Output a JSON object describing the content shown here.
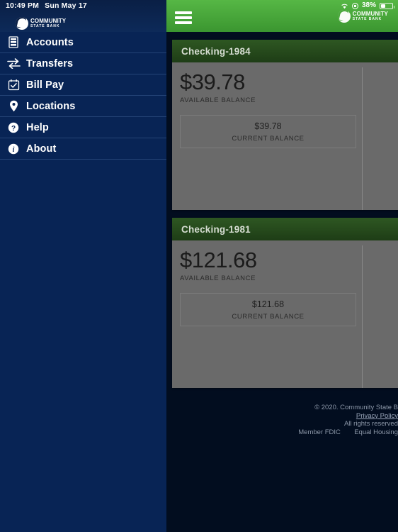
{
  "status_bar": {
    "time": "10:49 PM",
    "date": "Sun May 17",
    "battery_percent": "38%",
    "icons": [
      "wifi-icon",
      "rotation-lock-icon",
      "battery-icon"
    ]
  },
  "brand": {
    "logo_line1": "COMMUNITY",
    "logo_line2": "STATE  BANK",
    "green": "#4caf3f",
    "navy": "#082455"
  },
  "sidebar": {
    "items": [
      {
        "label": "Accounts",
        "icon": "bank-drawer-icon"
      },
      {
        "label": "Transfers",
        "icon": "transfer-arrows-icon"
      },
      {
        "label": "Bill Pay",
        "icon": "calendar-check-icon"
      },
      {
        "label": "Locations",
        "icon": "map-pin-icon"
      },
      {
        "label": "Help",
        "icon": "question-circle-icon"
      },
      {
        "label": "About",
        "icon": "info-circle-icon"
      }
    ]
  },
  "appbar": {
    "menu_icon": "hamburger-icon"
  },
  "accounts": [
    {
      "title": "Checking-1984",
      "available_amount": "$39.78",
      "available_label": "AVAILABLE BALANCE",
      "current_amount": "$39.78",
      "current_label": "CURRENT BALANCE"
    },
    {
      "title": "Checking-1981",
      "available_amount": "$121.68",
      "available_label": "AVAILABLE BALANCE",
      "current_amount": "$121.68",
      "current_label": "CURRENT BALANCE"
    }
  ],
  "footer": {
    "copyright": "© 2020. Community State B",
    "privacy_link": "Privacy Policy",
    "rights": "All rights reserved",
    "fdic": "Member FDIC",
    "equal_housing": "Equal Housing"
  }
}
